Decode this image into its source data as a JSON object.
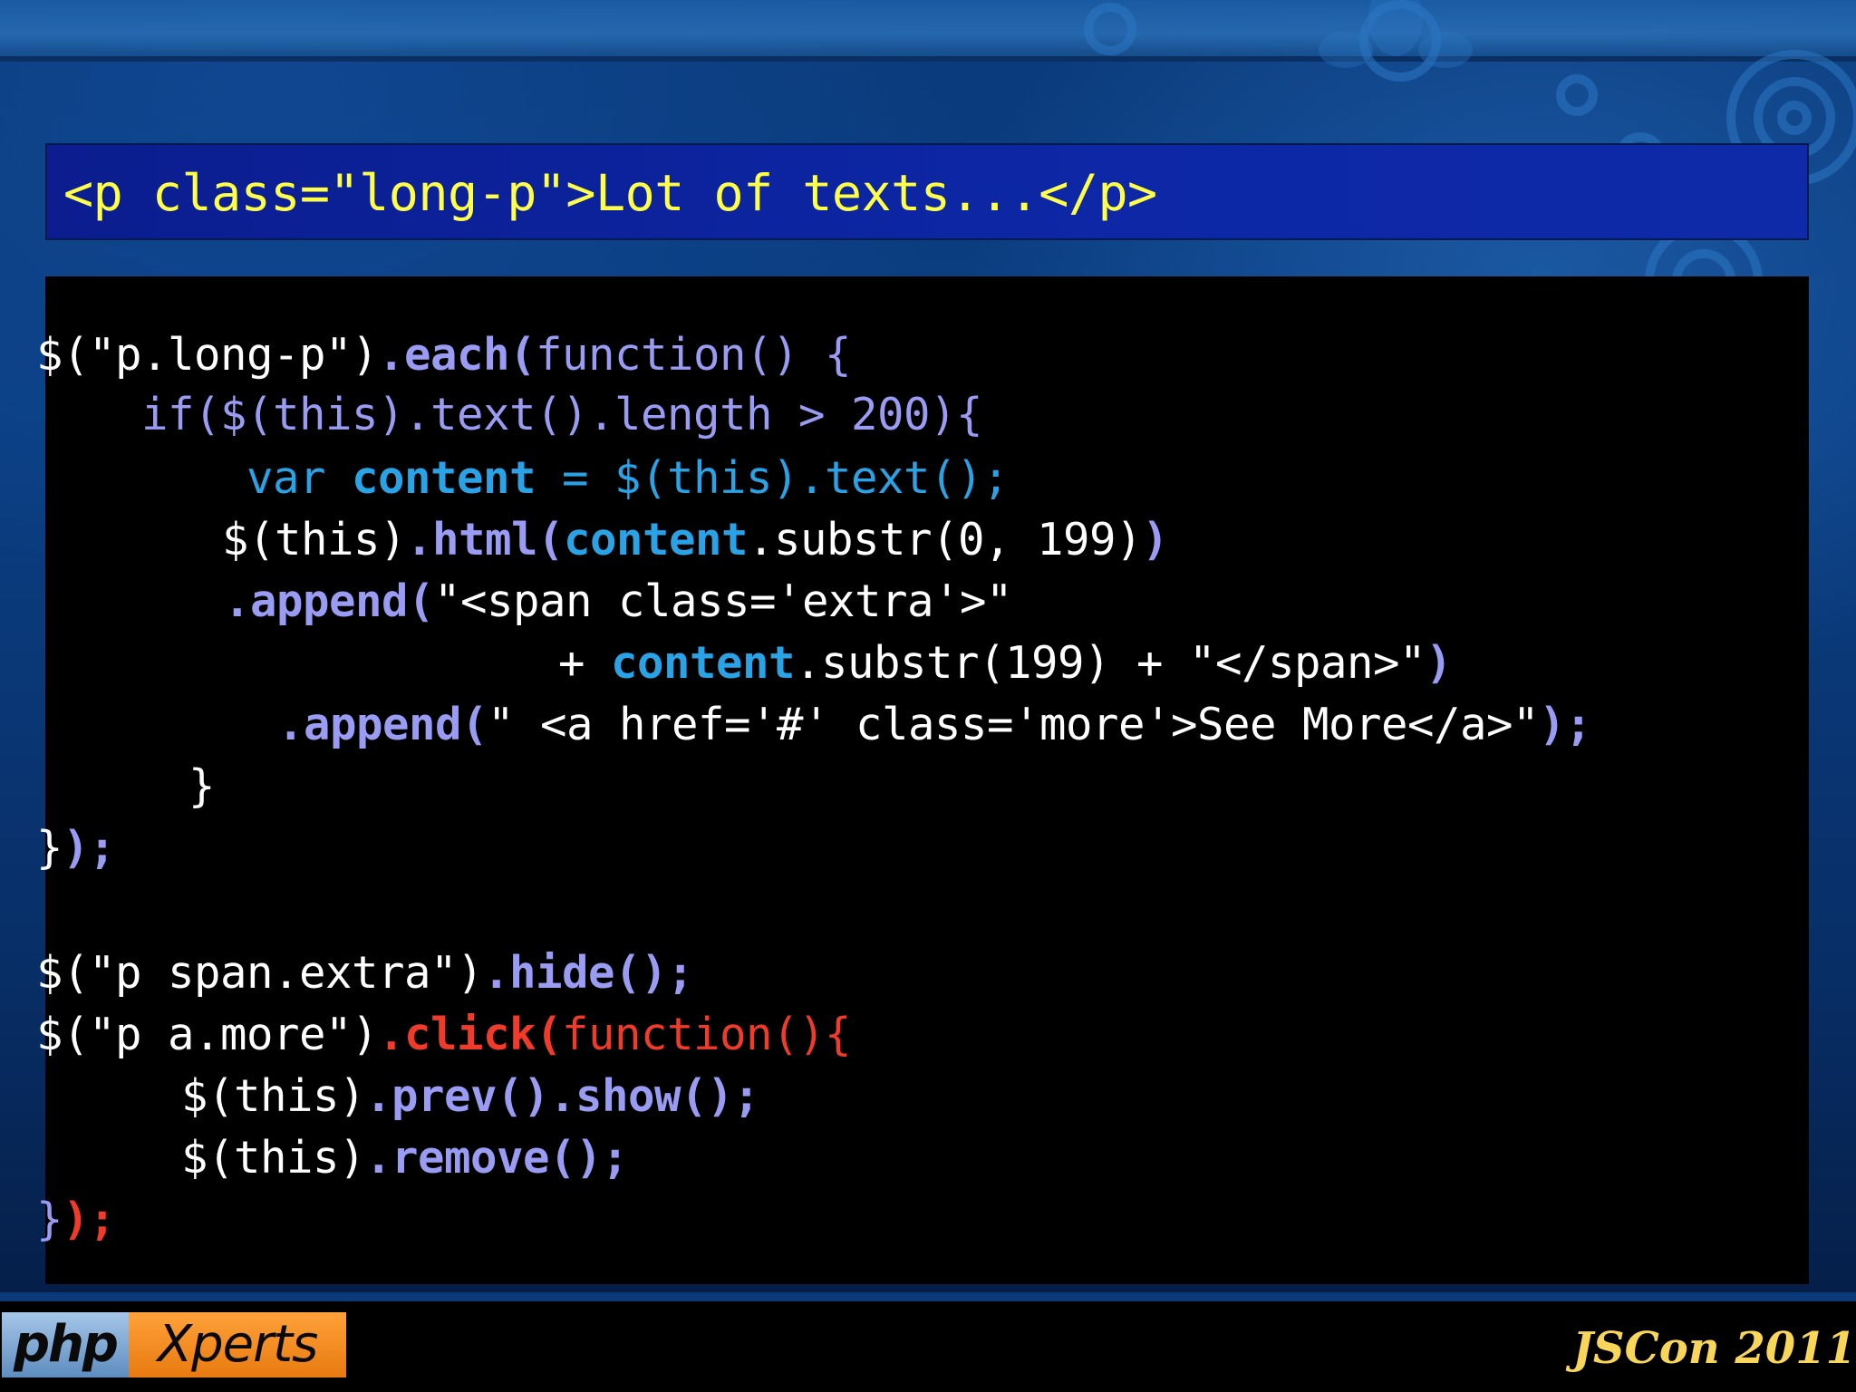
{
  "slide": {
    "title_code": "<p class=\"long-p\">Lot of texts...</p>",
    "code": [
      {
        "segments": [
          {
            "t": "$(\"p.long-p\")",
            "c": "w"
          },
          {
            "t": ".each(",
            "c": "pb"
          },
          {
            "t": "function() {",
            "c": "p"
          }
        ]
      },
      {
        "segments": [
          {
            "t": "    if($(this).text().length > 200){",
            "c": "p"
          }
        ]
      },
      {
        "segments": [
          {
            "t": "        var ",
            "c": "c"
          },
          {
            "t": "content",
            "c": "cb"
          },
          {
            "t": " = $(this).text();",
            "c": "c"
          }
        ]
      },
      {
        "segments": [
          {
            "t": "$(this)",
            "c": "w"
          },
          {
            "t": ".html(",
            "c": "pb"
          },
          {
            "t": "content",
            "c": "cb"
          },
          {
            "t": ".substr(0, 199)",
            "c": "w"
          },
          {
            "t": ")",
            "c": "pb"
          }
        ]
      },
      {
        "segments": [
          {
            "t": ".append(",
            "c": "pb"
          },
          {
            "t": "\"<span class='extra'>\"",
            "c": "w"
          }
        ]
      },
      {
        "segments": [
          {
            "t": "+ ",
            "c": "w"
          },
          {
            "t": "content",
            "c": "cb"
          },
          {
            "t": ".substr(199) + \"</span>\"",
            "c": "w"
          },
          {
            "t": ")",
            "c": "pb"
          }
        ]
      },
      {
        "segments": [
          {
            "t": ".append(",
            "c": "pb"
          },
          {
            "t": "\" <a href='#' class='more'>See More</a>\"",
            "c": "w"
          },
          {
            "t": ");",
            "c": "pb"
          }
        ]
      },
      {
        "segments": [
          {
            "t": "}",
            "c": "w"
          }
        ]
      },
      {
        "segments": [
          {
            "t": "}",
            "c": "w"
          },
          {
            "t": ");",
            "c": "pb"
          }
        ]
      },
      {
        "segments": [
          {
            "t": "$(\"p span.extra\")",
            "c": "w"
          },
          {
            "t": ".hide();",
            "c": "pb"
          }
        ]
      },
      {
        "segments": [
          {
            "t": "$(\"p a.more\")",
            "c": "w"
          },
          {
            "t": ".click(",
            "c": "rb"
          },
          {
            "t": "function(){",
            "c": "r"
          }
        ]
      },
      {
        "segments": [
          {
            "t": "$(this)",
            "c": "w"
          },
          {
            "t": ".prev().show();",
            "c": "pb"
          }
        ]
      },
      {
        "segments": [
          {
            "t": "$(this)",
            "c": "w"
          },
          {
            "t": ".remove();",
            "c": "pb"
          }
        ]
      },
      {
        "segments": [
          {
            "t": "}",
            "c": "p"
          },
          {
            "t": ");",
            "c": "rb"
          }
        ]
      }
    ]
  },
  "footer": {
    "logo_left": "php",
    "logo_right": "Xperts",
    "event": "JSCon 2011"
  },
  "colors": {
    "title_text": "#ffff4a",
    "title_bg": "#0d27a6",
    "code_bg": "#000000",
    "keyword_purple": "#9a9cf4",
    "keyword_blue": "#2aa2e6",
    "keyword_red": "#f03a2a",
    "footer_text": "#f7d65a",
    "logo_orange": "#ff9a2e",
    "logo_blue": "#7aa3d4"
  }
}
